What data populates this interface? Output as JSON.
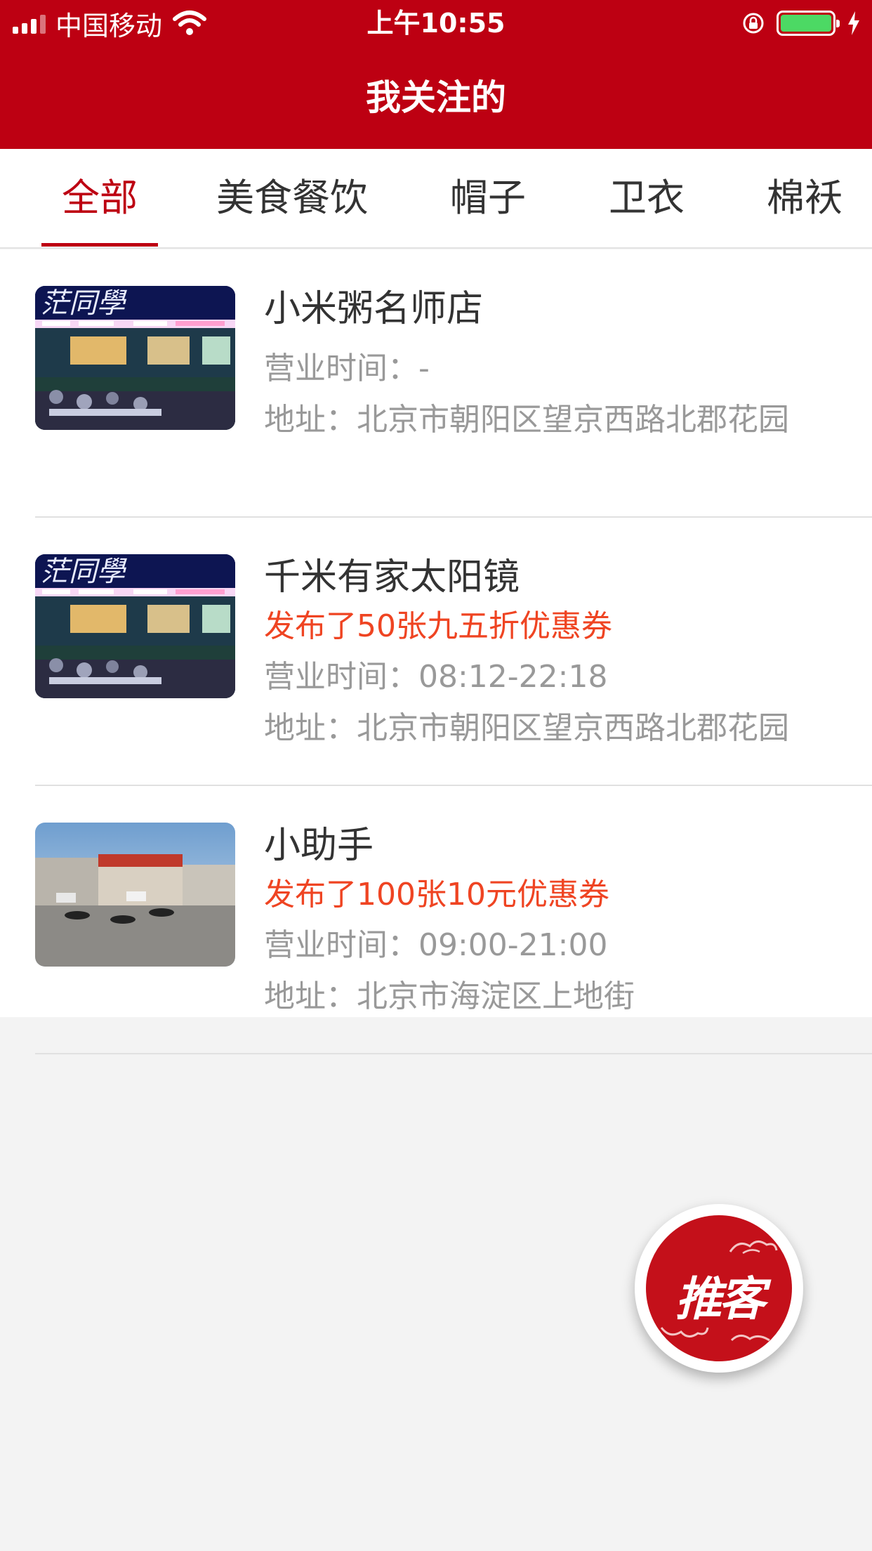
{
  "status_bar": {
    "carrier": "中国移动",
    "time": "上午10:55"
  },
  "nav": {
    "title": "我关注的"
  },
  "tabs": [
    {
      "label": "全部",
      "active": true
    },
    {
      "label": "美食餐饮",
      "active": false
    },
    {
      "label": "帽子",
      "active": false
    },
    {
      "label": "卫衣",
      "active": false
    },
    {
      "label": "棉袄",
      "active": false
    }
  ],
  "stores": [
    {
      "name": "小米粥名师店",
      "hours": "营业时间：-",
      "address": "地址：北京市朝阳区望京西路北郡花园"
    },
    {
      "name": "千米有家太阳镜",
      "promo": "发布了50张九五折优惠券",
      "hours": "营业时间：08:12-22:18",
      "address": "地址：北京市朝阳区望京西路北郡花园"
    },
    {
      "name": "小助手",
      "promo": "发布了100张10元优惠券",
      "hours": "营业时间：09:00-21:00",
      "address": "地址：北京市海淀区上地街"
    }
  ],
  "fab": {
    "label": "推客"
  },
  "colors": {
    "brand_red": "#bd0012",
    "promo_orange": "#ef4422",
    "secondary_gray": "#999999"
  },
  "icons": [
    "signal-icon",
    "wifi-icon",
    "rotation-lock-icon",
    "battery-icon",
    "charging-icon"
  ]
}
